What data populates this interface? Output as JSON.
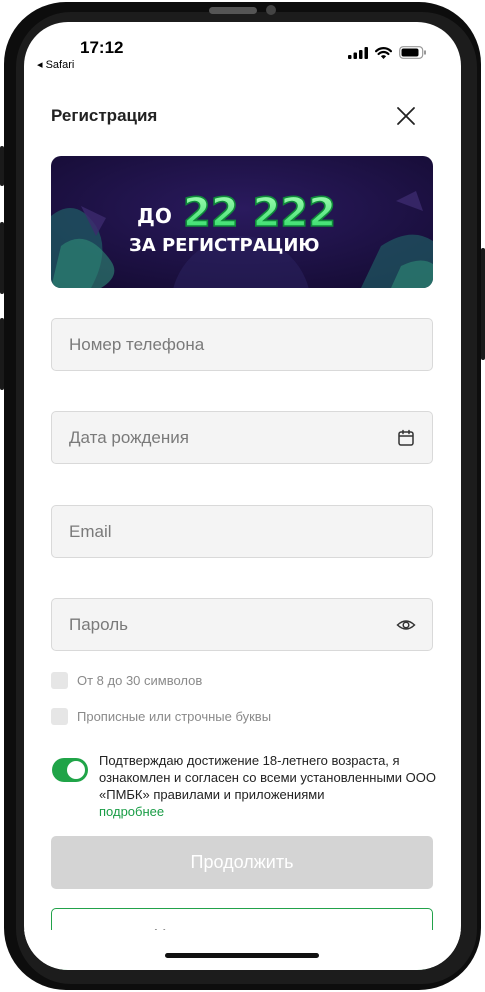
{
  "status_bar": {
    "time": "17:12",
    "back_app": "◂ Safari"
  },
  "header": {
    "title": "Регистрация"
  },
  "banner": {
    "line1_prefix": "ДО",
    "amount": "22 222",
    "line2": "ЗА РЕГИСТРАЦИЮ"
  },
  "form": {
    "phone_placeholder": "Номер телефона",
    "birthdate_placeholder": "Дата рождения",
    "email_placeholder": "Email",
    "password_placeholder": "Пароль"
  },
  "password_rules": [
    {
      "label": "От 8 до 30 символов"
    },
    {
      "label": "Прописные или строчные буквы"
    }
  ],
  "consent": {
    "text": "Подтверждаю достижение 18-летнего возраста, я ознакомлен и согласен со всеми установленными ООО «ПМБК» правилами и приложениями",
    "link": "подробнее",
    "enabled": true
  },
  "buttons": {
    "continue": "Продолжить",
    "secondary": "У меня есть промокод"
  },
  "colors": {
    "accent": "#20a448",
    "banner_bg": "#1d1245",
    "disabled_button": "#d4d4d4"
  }
}
